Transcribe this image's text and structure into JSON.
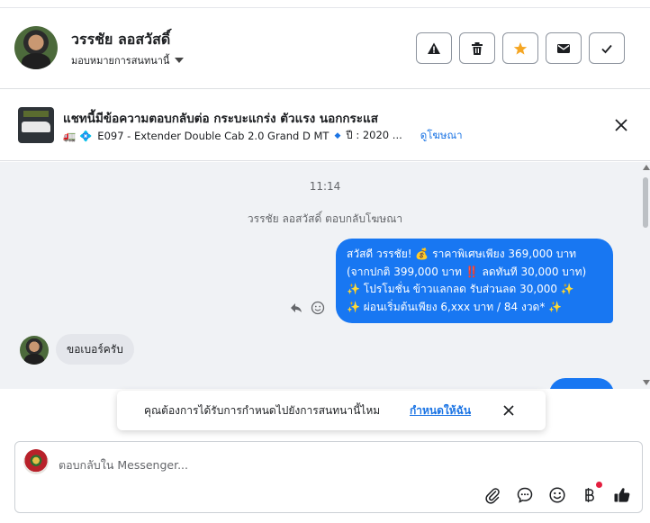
{
  "header": {
    "user_name": "วรรชัย ลอสวัสดิ์",
    "assign_label": "มอบหมายการสนทนานี้",
    "actions": [
      "spam-icon",
      "trash-icon",
      "star-icon",
      "envelope-icon",
      "check-icon"
    ],
    "star_color": "#f5a623"
  },
  "ad": {
    "title": "แชทนี้มีข้อความตอบกลับต่อ กระบะแกร่ง ตัวแรง นอกกระแส",
    "subtitle_emojis": "🚛 💠",
    "subtitle": "E097 - Extender Double Cab 2.0 Grand D MT",
    "year": "ปี : 2020 ...",
    "link": "ดูโฆษณา"
  },
  "chat": {
    "timestamp": "11:14",
    "replied_notice": "วรรชัย ลอสวัสดิ์ ตอบกลับโฆษณา",
    "outgoing_lines": [
      "สวัสดี วรรชัย! 💰 ราคาพิเศษเพียง 369,000 บาท",
      "(จากปกติ 399,000 บาท ‼️ ลดทันที 30,000 บาท)",
      "✨ โปรโมชั่น ข้าวแลกลด รับส่วนลด 30,000 ✨",
      "✨ ผ่อนเริ่มต้นเพียง 6,xxx บาท / 84 งวด* ✨"
    ],
    "incoming": "ขอเบอร์ครับ",
    "bubble_color": "#1877f2"
  },
  "toast": {
    "text": "คุณต้องการได้รับการกำหนดไปยังการสนทนานี้ไหม",
    "link": "กำหนดให้ฉัน"
  },
  "composer": {
    "placeholder": "ตอบกลับใน Messenger...",
    "tools": [
      "attach-icon",
      "saved-reply-icon",
      "emoji-icon",
      "baht-icon",
      "thumbs-up-icon"
    ]
  }
}
